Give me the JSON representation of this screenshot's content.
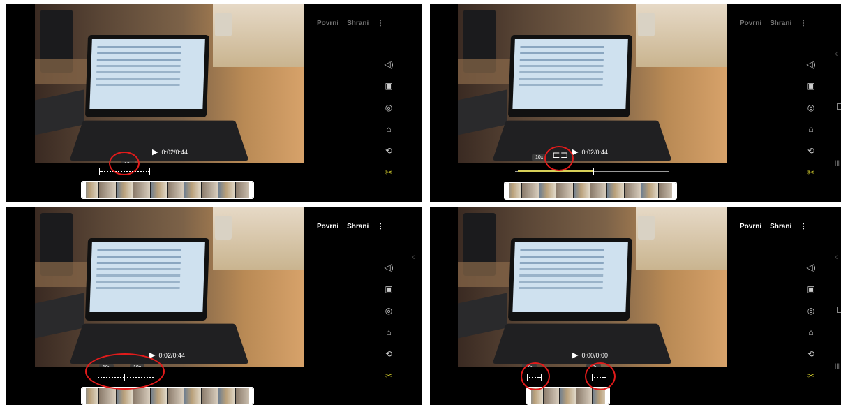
{
  "actions": {
    "revert": "Povrni",
    "save": "Shrani",
    "more": "⋮"
  },
  "video": {
    "time": "0:02/0:44",
    "time_alt": "0:00/0:00"
  },
  "speed": {
    "label": "10x"
  },
  "toolbar": {
    "icons": [
      "volume-icon",
      "sticker-icon",
      "filter-icon",
      "adjust-icon",
      "rotate-icon",
      "cut-icon"
    ]
  },
  "colors": {
    "annotation": "#e21b1b",
    "accent": "#c7c02a"
  }
}
